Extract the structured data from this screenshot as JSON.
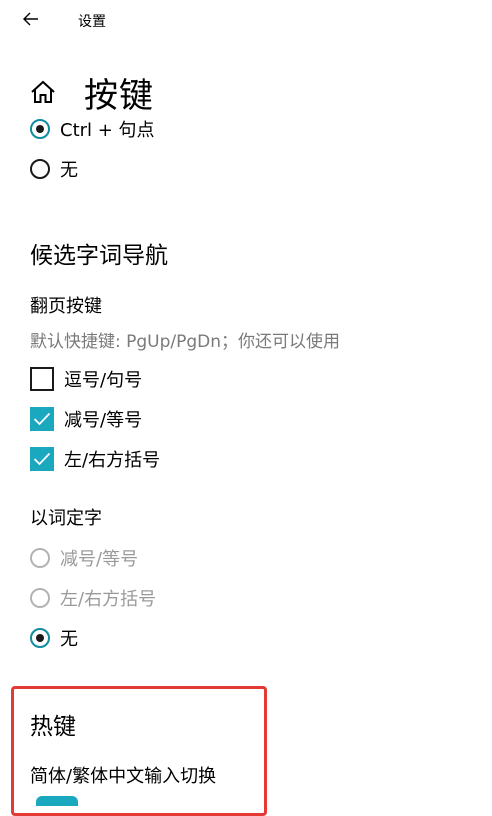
{
  "titlebar": {
    "title": "设置"
  },
  "page": {
    "title": "按键"
  },
  "radios_top": [
    {
      "label": "Ctrl + 句点",
      "checked": true
    },
    {
      "label": "无",
      "checked": false
    }
  ],
  "candidate_nav": {
    "title": "候选字词导航",
    "page_keys": {
      "title": "翻页按键",
      "description": "默认快捷键: PgUp/PgDn；你还可以使用",
      "options": [
        {
          "label": "逗号/句号",
          "checked": false
        },
        {
          "label": "减号/等号",
          "checked": true
        },
        {
          "label": "左/右方括号",
          "checked": true
        }
      ]
    },
    "word_to_char": {
      "title": "以词定字",
      "options": [
        {
          "label": "减号/等号",
          "checked": false,
          "disabled": true
        },
        {
          "label": "左/右方括号",
          "checked": false,
          "disabled": true
        },
        {
          "label": "无",
          "checked": true,
          "disabled": false
        }
      ]
    }
  },
  "hotkeys": {
    "title": "热键",
    "switch_label": "简体/繁体中文输入切换"
  },
  "colors": {
    "accent": "#1aa8bf",
    "highlight": "#e53935"
  }
}
